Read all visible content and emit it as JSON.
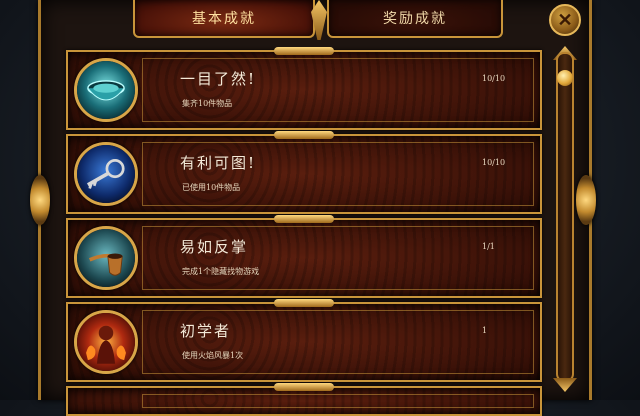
{
  "tabs": {
    "basic": "基本成就",
    "reward": "奖励成就"
  },
  "close_label": "✕",
  "achievements": [
    {
      "title": "一目了然!",
      "desc": "集齐10件物品",
      "progress": "10/10",
      "icon": "bowl-icon"
    },
    {
      "title": "有利可图!",
      "desc": "已使用10件物品",
      "progress": "10/10",
      "icon": "key-icon"
    },
    {
      "title": "易如反掌",
      "desc": "完成1个隐藏找物游戏",
      "progress": "1/1",
      "icon": "pipe-icon"
    },
    {
      "title": "初学者",
      "desc": "使用火焰风暴1次",
      "progress": "1",
      "icon": "fire-mage-icon"
    }
  ],
  "colors": {
    "gold": "#c9953a",
    "card_red": "#5a1e0e",
    "text": "#f4ead8"
  }
}
